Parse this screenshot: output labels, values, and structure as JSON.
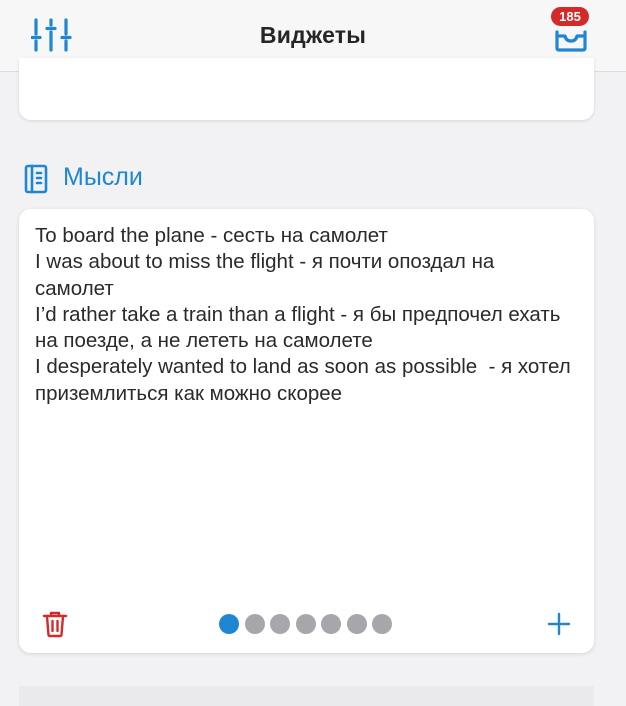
{
  "header": {
    "title": "Виджеты",
    "badge_count": "185"
  },
  "section": {
    "title": "Мысли"
  },
  "note": {
    "text": "To board the plane - сесть на самолет\nI was about to miss the flight - я почти опоздал на самолет\nI’d rather take a train than a flight - я бы предпочел ехать на поезде, а не лететь на самолете\nI desperately wanted to land as soon as possible  - я хотел приземлиться как можно скорее"
  },
  "pagination": {
    "total": 7,
    "active": 1
  },
  "icons": {
    "settings": "sliders-icon",
    "inbox": "inbox-icon",
    "section": "notebook-icon",
    "delete": "trash-icon",
    "add": "plus-icon"
  },
  "colors": {
    "accent": "#1f86d4",
    "badge": "#d42a2a",
    "delete": "#d42a2a",
    "dot_inactive": "#a7a7ab"
  }
}
